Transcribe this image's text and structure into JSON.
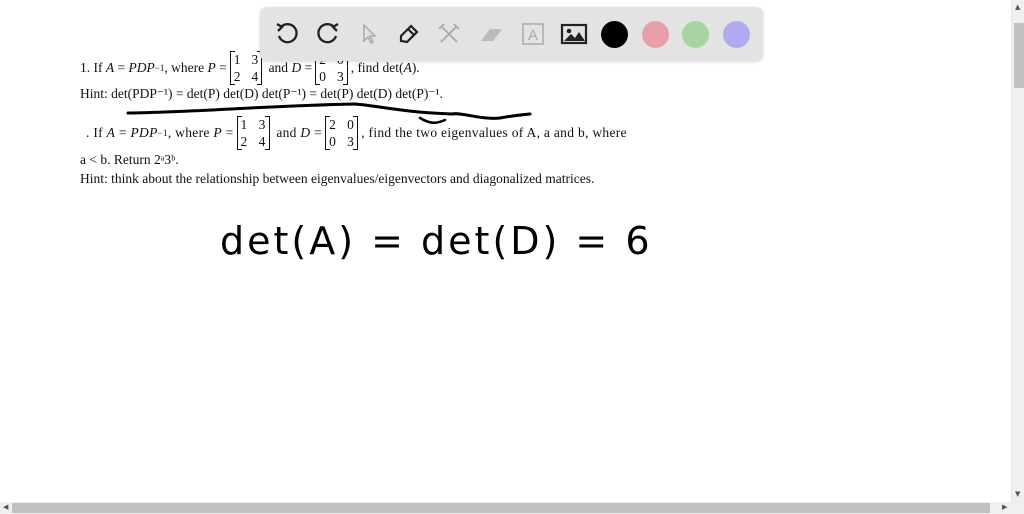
{
  "toolbar": {
    "tools": [
      "undo-icon",
      "redo-icon",
      "pointer-icon",
      "pen-icon",
      "tools-icon",
      "eraser-icon",
      "text-icon",
      "image-icon"
    ],
    "colors": [
      "#000000",
      "#e8a0a8",
      "#a8d4a4",
      "#b0aaf0"
    ],
    "text_tool_glyph": "A"
  },
  "problem1": {
    "number": "1. If",
    "A": "A",
    "eq": "=",
    "PDP": "PDP",
    "inv": "−1",
    "where": ", where",
    "P": "P",
    "and": "and",
    "D": "D",
    "P_matrix": [
      [
        "1",
        "3"
      ],
      [
        "2",
        "4"
      ]
    ],
    "D_matrix": [
      [
        "2",
        "0"
      ],
      [
        "0",
        "3"
      ]
    ],
    "tail": ", find det(",
    "tail_var": "A",
    "tail_end": ")."
  },
  "hint1": "Hint: det(PDP⁻¹) = det(P) det(D) det(P⁻¹) = det(P) det(D) det(P)⁻¹.",
  "problem2": {
    "number": ".  If",
    "A": "A",
    "eq": "=",
    "PDP": "PDP",
    "inv": "−1",
    "where": ", where",
    "P": "P",
    "and": "and",
    "D": "D",
    "P_matrix": [
      [
        "1",
        "3"
      ],
      [
        "2",
        "4"
      ]
    ],
    "D_matrix": [
      [
        "2",
        "0"
      ],
      [
        "0",
        "3"
      ]
    ],
    "tail": ", find the two eigenvalues of A, a and b, where",
    "line2": "a < b. Return 2ᵃ3ᵇ."
  },
  "hint2": "Hint: think about the relationship between eigenvalues/eigenvectors and diagonalized matrices.",
  "handwriting": "det(A) = det(D) = 6"
}
